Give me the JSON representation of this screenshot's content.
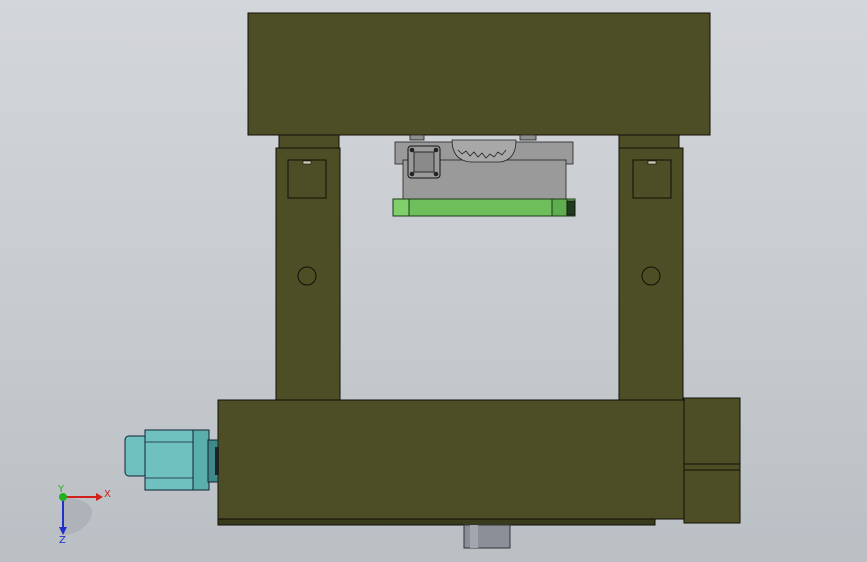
{
  "view": {
    "colors": {
      "background_top": "#d3d6da",
      "background_bottom": "#babfc4",
      "frame_fill": "#4e4e26",
      "frame_dark": "#3a3a1c",
      "edge": "#101008",
      "motor_teal": "#6fc1bf",
      "motor_teal_dark": "#3f8a88",
      "plate_green": "#6fbe5c",
      "plate_green_dark": "#3f7d33",
      "mechanism_gray": "#9a9a9a",
      "shaft_gray": "#8c8f98"
    }
  },
  "triad": {
    "x_label": "X",
    "y_label": "Y",
    "z_label": "Z",
    "x_color": "#d4201c",
    "y_color": "#22b022",
    "z_color": "#2030c8"
  }
}
